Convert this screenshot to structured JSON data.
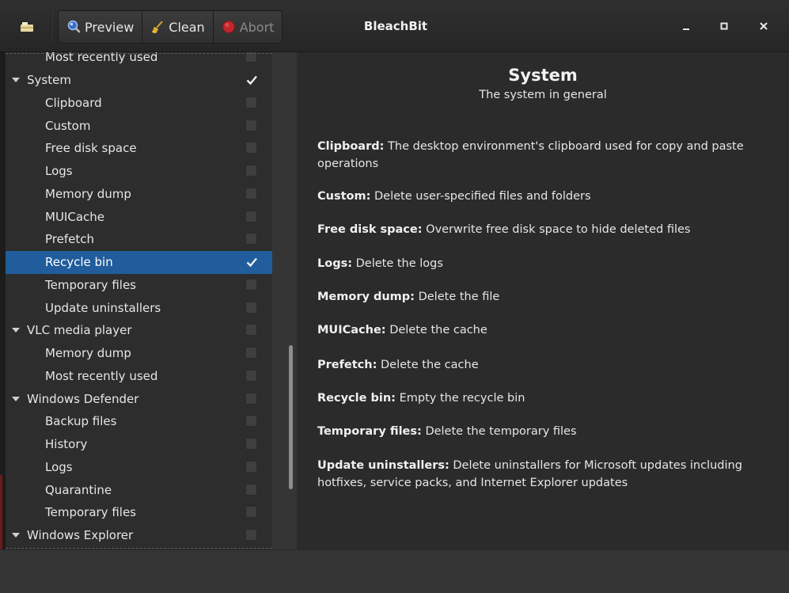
{
  "window": {
    "title": "BleachBit"
  },
  "toolbar": {
    "preview_label": "Preview",
    "clean_label": "Clean",
    "abort_label": "Abort"
  },
  "icons": {
    "app": "bleachbit-app-icon",
    "preview": "magnifier-icon",
    "clean": "broom-icon",
    "abort": "stop-icon",
    "minimize": "minimize-icon",
    "maximize": "maximize-icon",
    "close": "close-icon"
  },
  "colors": {
    "selection": "#215d9c",
    "background": "#2b2b2b",
    "abort_red": "#c0282d"
  },
  "tree": [
    {
      "label": "Most recently used",
      "level": 1,
      "checked": false,
      "expanded": false,
      "selected": false
    },
    {
      "label": "System",
      "level": 0,
      "checked": true,
      "expanded": true,
      "selected": false
    },
    {
      "label": "Clipboard",
      "level": 1,
      "checked": false,
      "expanded": false,
      "selected": false
    },
    {
      "label": "Custom",
      "level": 1,
      "checked": false,
      "expanded": false,
      "selected": false
    },
    {
      "label": "Free disk space",
      "level": 1,
      "checked": false,
      "expanded": false,
      "selected": false
    },
    {
      "label": "Logs",
      "level": 1,
      "checked": false,
      "expanded": false,
      "selected": false
    },
    {
      "label": "Memory dump",
      "level": 1,
      "checked": false,
      "expanded": false,
      "selected": false
    },
    {
      "label": "MUICache",
      "level": 1,
      "checked": false,
      "expanded": false,
      "selected": false
    },
    {
      "label": "Prefetch",
      "level": 1,
      "checked": false,
      "expanded": false,
      "selected": false
    },
    {
      "label": "Recycle bin",
      "level": 1,
      "checked": true,
      "expanded": false,
      "selected": true
    },
    {
      "label": "Temporary files",
      "level": 1,
      "checked": false,
      "expanded": false,
      "selected": false
    },
    {
      "label": "Update uninstallers",
      "level": 1,
      "checked": false,
      "expanded": false,
      "selected": false
    },
    {
      "label": "VLC media player",
      "level": 0,
      "checked": false,
      "expanded": true,
      "selected": false
    },
    {
      "label": "Memory dump",
      "level": 1,
      "checked": false,
      "expanded": false,
      "selected": false
    },
    {
      "label": "Most recently used",
      "level": 1,
      "checked": false,
      "expanded": false,
      "selected": false
    },
    {
      "label": "Windows Defender",
      "level": 0,
      "checked": false,
      "expanded": true,
      "selected": false
    },
    {
      "label": "Backup files",
      "level": 1,
      "checked": false,
      "expanded": false,
      "selected": false
    },
    {
      "label": "History",
      "level": 1,
      "checked": false,
      "expanded": false,
      "selected": false
    },
    {
      "label": "Logs",
      "level": 1,
      "checked": false,
      "expanded": false,
      "selected": false
    },
    {
      "label": "Quarantine",
      "level": 1,
      "checked": false,
      "expanded": false,
      "selected": false
    },
    {
      "label": "Temporary files",
      "level": 1,
      "checked": false,
      "expanded": false,
      "selected": false
    },
    {
      "label": "Windows Explorer",
      "level": 0,
      "checked": false,
      "expanded": true,
      "selected": false
    }
  ],
  "detail": {
    "title": "System",
    "subtitle": "The system in general",
    "options": [
      {
        "name": "Clipboard:",
        "text": "The desktop environment's clipboard used for copy and paste operations"
      },
      {
        "name": "Custom:",
        "text": "Delete user-specified files and folders"
      },
      {
        "name": "Free disk space:",
        "text": "Overwrite free disk space to hide deleted files"
      },
      {
        "name": "Logs:",
        "text": "Delete the logs"
      },
      {
        "name": "Memory dump:",
        "text": "Delete the file"
      },
      {
        "name": "MUICache:",
        "text": "Delete the cache"
      },
      {
        "name": "Prefetch:",
        "text": "Delete the cache"
      },
      {
        "name": "Recycle bin:",
        "text": "Empty the recycle bin"
      },
      {
        "name": "Temporary files:",
        "text": "Delete the temporary files"
      },
      {
        "name": "Update uninstallers:",
        "text": "Delete uninstallers for Microsoft updates including hotfixes, service packs, and Internet Explorer updates"
      }
    ]
  }
}
